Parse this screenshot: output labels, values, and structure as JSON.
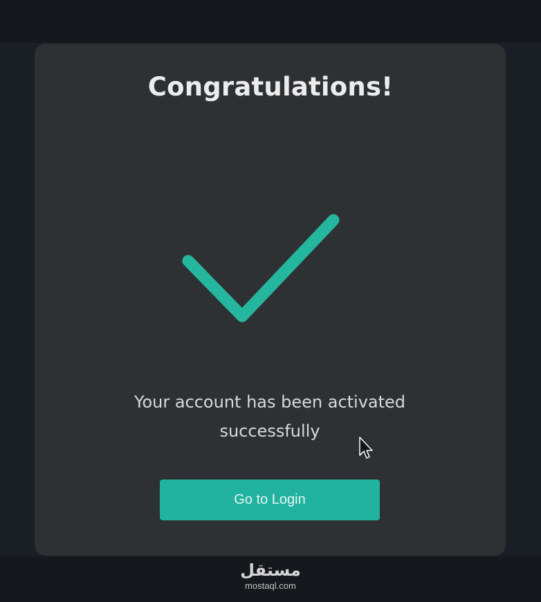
{
  "card": {
    "title": "Congratulations!",
    "message": "Your account has been activated successfully",
    "button_label": "Go to Login"
  },
  "icons": {
    "success": "checkmark-icon",
    "pointer": "mouse-cursor-icon"
  },
  "watermark": {
    "logo": "مستقل",
    "domain": "mostaql.com"
  },
  "colors": {
    "accent": "#22b3a0",
    "card_background": "#2e3134",
    "page_background": "#1a1e25"
  }
}
